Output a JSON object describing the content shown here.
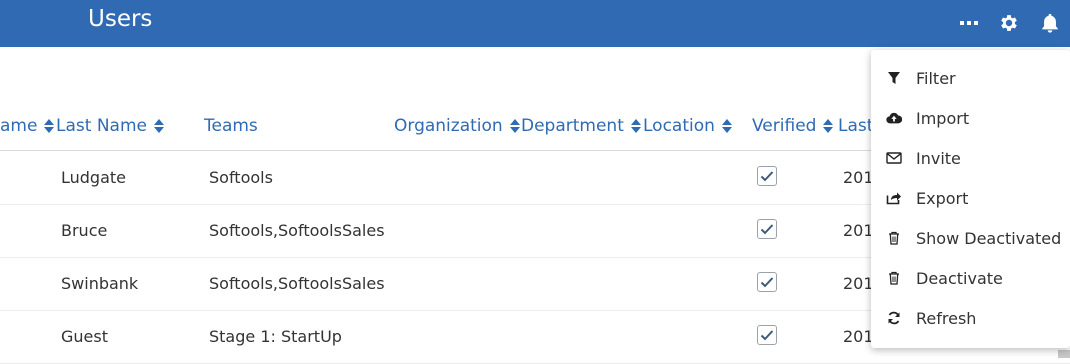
{
  "header": {
    "title": "Users",
    "brand_color": "#2f6ab3",
    "icons": [
      "more-icon",
      "gear-icon",
      "bell-icon"
    ]
  },
  "table": {
    "columns": [
      {
        "key": "first_name",
        "label": "ame",
        "sortable": true
      },
      {
        "key": "last_name",
        "label": "Last Name",
        "sortable": true
      },
      {
        "key": "teams",
        "label": "Teams",
        "sortable": false
      },
      {
        "key": "organization",
        "label": "Organization",
        "sortable": true
      },
      {
        "key": "department",
        "label": "Department",
        "sortable": true
      },
      {
        "key": "location",
        "label": "Location",
        "sortable": true
      },
      {
        "key": "verified",
        "label": "Verified",
        "sortable": true
      },
      {
        "key": "last",
        "label": "Last",
        "sortable": false
      }
    ],
    "rows": [
      {
        "last_name": "Ludgate",
        "teams": "Softools",
        "verified": true,
        "last": "201"
      },
      {
        "last_name": "Bruce",
        "teams": "Softools,SoftoolsSales",
        "verified": true,
        "last": "201"
      },
      {
        "last_name": "Swinbank",
        "teams": "Softools,SoftoolsSales",
        "verified": true,
        "last": "201"
      },
      {
        "last_name": "Guest",
        "teams": "Stage 1: StartUp",
        "verified": true,
        "last": "201"
      }
    ]
  },
  "menu": {
    "items": [
      {
        "label": "Filter",
        "icon": "filter-icon"
      },
      {
        "label": "Import",
        "icon": "cloud-upload-icon"
      },
      {
        "label": "Invite",
        "icon": "envelope-icon"
      },
      {
        "label": "Export",
        "icon": "share-icon"
      },
      {
        "label": "Show Deactivated",
        "icon": "trash-icon"
      },
      {
        "label": "Deactivate",
        "icon": "trash-icon"
      },
      {
        "label": "Refresh",
        "icon": "refresh-icon"
      }
    ]
  }
}
